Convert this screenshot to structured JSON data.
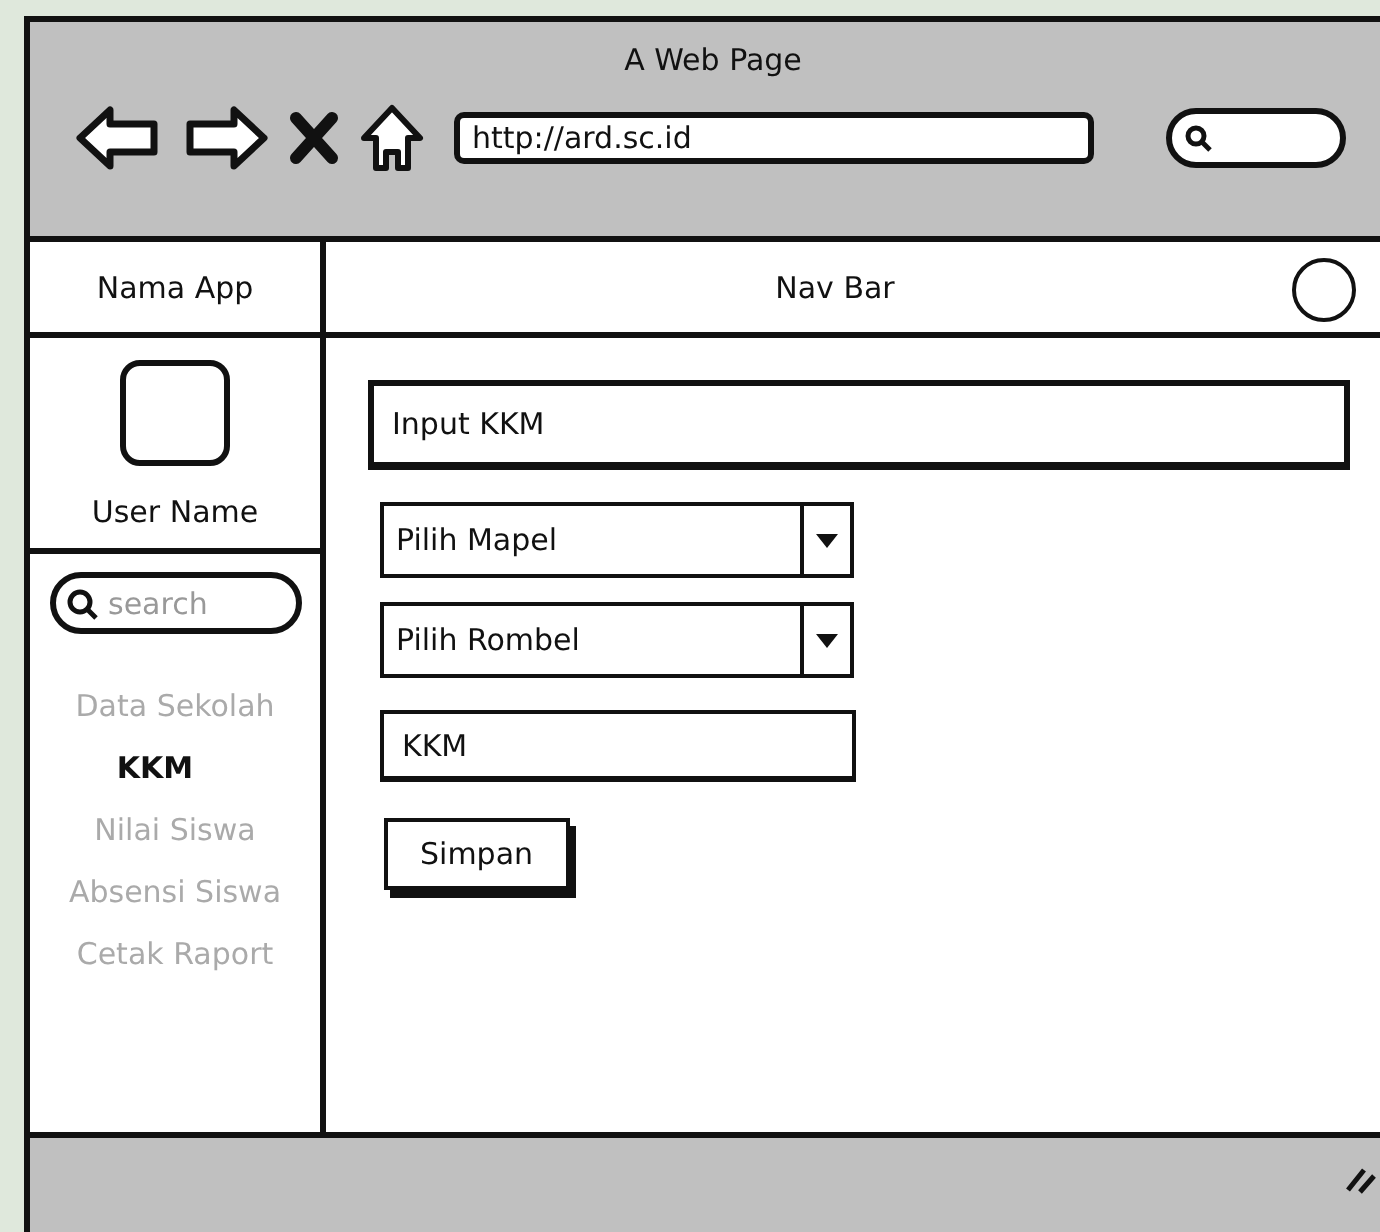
{
  "window": {
    "title": "A Web Page"
  },
  "toolbar": {
    "url": "http://ard.sc.id"
  },
  "navbar": {
    "app_name": "Nama App",
    "title": "Nav Bar"
  },
  "sidebar": {
    "user_name": "User Name",
    "search": {
      "placeholder": "search"
    },
    "items": [
      {
        "label": "Data Sekolah",
        "selected": false
      },
      {
        "label": "KKM",
        "selected": true
      },
      {
        "label": "Nilai Siswa",
        "selected": false
      },
      {
        "label": "Absensi Siswa",
        "selected": false
      },
      {
        "label": "Cetak Raport",
        "selected": false
      }
    ]
  },
  "form": {
    "heading_field": "Input KKM",
    "selects": [
      {
        "value": "Pilih Mapel"
      },
      {
        "value": "Pilih Rombel"
      }
    ],
    "kkm_field": {
      "value": "KKM"
    },
    "button": "Simpan"
  }
}
